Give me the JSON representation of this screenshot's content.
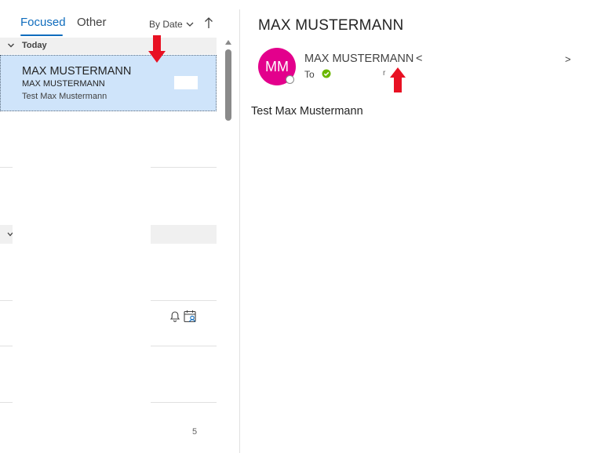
{
  "tabs": {
    "focused": "Focused",
    "other": "Other"
  },
  "sort": {
    "label": "By Date"
  },
  "groups": {
    "today": "Today"
  },
  "message": {
    "sender": "MAX MUSTERMANN",
    "subject": "MAX MUSTERMANN",
    "preview": "Test Max Mustermann"
  },
  "list_fragment": {
    "text": "5"
  },
  "reading": {
    "subject": "MAX MUSTERMANN",
    "avatar_initials": "MM",
    "from_name": "MAX MUSTERMANN",
    "from_open": "<",
    "from_close": ">",
    "to_label": "To",
    "to_tick": "r",
    "body": "Test Max Mustermann"
  },
  "colors": {
    "accent": "#0f6cbd",
    "selected_row": "#cfe4fa",
    "avatar": "#e3008c",
    "annotation_arrow": "#e81123",
    "presence_ok": "#6bb700"
  }
}
